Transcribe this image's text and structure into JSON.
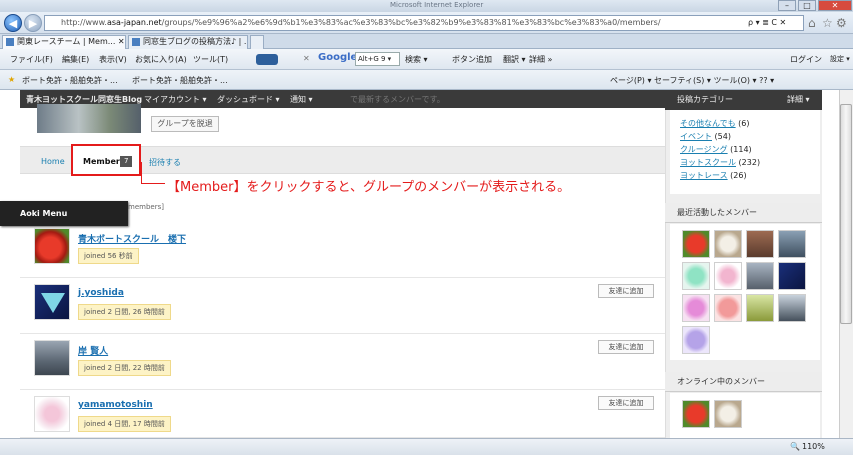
{
  "window": {
    "title": "Microsoft Internet Explorer",
    "min": "–",
    "max": "□",
    "close": "✕"
  },
  "address": {
    "prefix": "http://www.",
    "domain": "asa-japan.net",
    "path": "/groups/%e9%96%a2%e6%9d%b1%e3%83%ac%e3%83%bc%e3%82%b9%e3%83%81%e3%83%bc%e3%83%a0/members/",
    "controls": "ρ ▾ ≣ C ✕"
  },
  "tabs": [
    {
      "label": "関東レースチーム | Mem... ✕"
    },
    {
      "label": "同窓生ブログの投稿方法♪ | ..."
    }
  ],
  "menubar": {
    "items": [
      "ファイル(F)",
      "編集(E)",
      "表示(V)",
      "お気に入り(A)",
      "ツール(T)"
    ],
    "search_label": "Google",
    "search_value": "Alt+G 9 ▾",
    "search_btn": "検索 ▾",
    "add_btn": "ボタン追加",
    "translate": "翻訳 ▾",
    "detail": "詳細 »",
    "login": "ログイン",
    "settings": "設定 ▾"
  },
  "favbar": {
    "items": [
      "ボート免許・船舶免許・...",
      "ボート免許・船舶免許・..."
    ],
    "right": "ページ(P) ▾   セーフティ(S) ▾   ツール(O) ▾   ?? ▾"
  },
  "adminbar": {
    "site": "青木ヨットスクール同窓生Blog",
    "items": [
      "マイアカウント ▾",
      "ダッシュボード ▾",
      "通知 ▾"
    ],
    "hidden_text": "で最新するメンバーです。"
  },
  "group": {
    "leave_label": "グループを脱退"
  },
  "subnav": {
    "home": "Home",
    "members": "Members",
    "members_count": "7",
    "invite": "招待する"
  },
  "callout": "【Member】をクリックすると、グループのメンバーが表示される。",
  "aoki_menu": "Aoki Menu",
  "members_label": "members]",
  "members": [
    {
      "name": "青木ボートスクール　楼下",
      "joined": "joined 56 秒前",
      "add": ""
    },
    {
      "name": "j.yoshida",
      "joined": "joined 2 日間, 26 時間前",
      "add": "友達に追加"
    },
    {
      "name": "岸 賢人",
      "joined": "joined 2 日間, 22 時間前",
      "add": "友達に追加"
    },
    {
      "name": "yamamotoshin",
      "joined": "joined 4 日間, 17 時間前",
      "add": "友達に追加"
    }
  ],
  "sidebar": {
    "categories_title": "投稿カテゴリー",
    "categories_right": "詳細 ▾",
    "categories": [
      {
        "name": "その他なんでも",
        "count": "(6)"
      },
      {
        "name": "イベント",
        "count": "(54)"
      },
      {
        "name": "クルージング",
        "count": "(114)"
      },
      {
        "name": "ヨットスクール",
        "count": "(232)"
      },
      {
        "name": "ヨットレース",
        "count": "(26)"
      }
    ],
    "recent_title": "最近活動したメンバー",
    "online_title": "オンライン中のメンバー"
  },
  "status": {
    "zoom": "110%"
  }
}
